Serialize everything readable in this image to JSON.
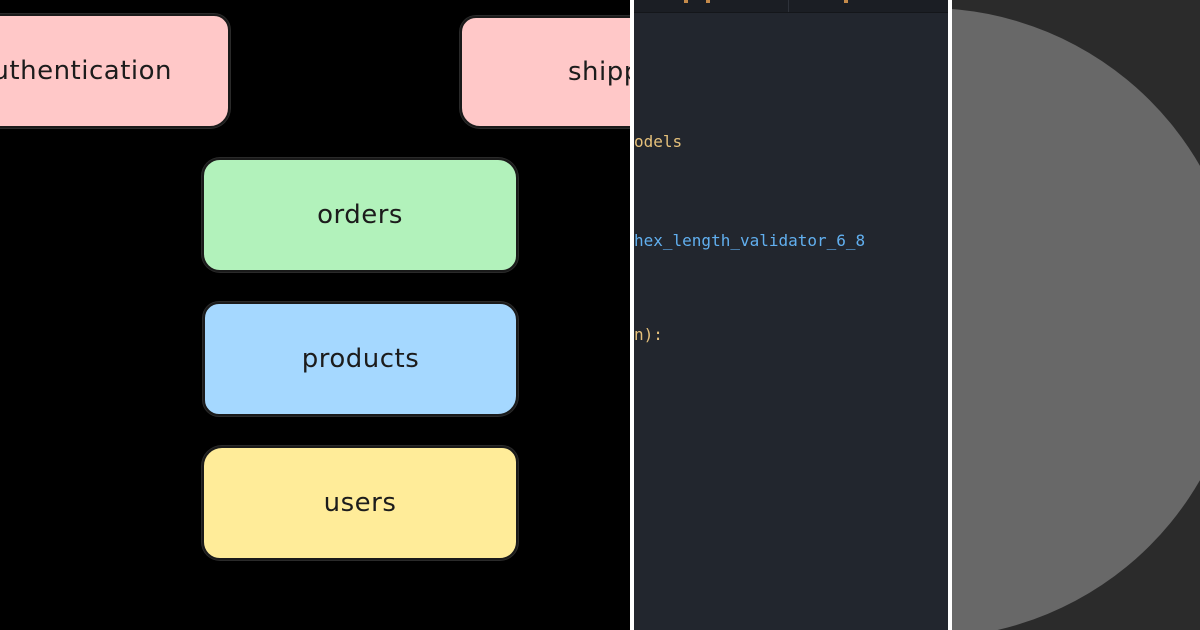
{
  "diagram": {
    "modules": [
      {
        "id": "authentication",
        "label": "uthentication",
        "color": "#ffc8c8"
      },
      {
        "id": "shipping",
        "label": "shipp",
        "color": "#ffc8c8"
      },
      {
        "id": "orders",
        "label": "orders",
        "color": "#b2f2bb"
      },
      {
        "id": "products",
        "label": "products",
        "color": "#a5d8ff"
      },
      {
        "id": "users",
        "label": "users",
        "color": "#ffec99"
      }
    ]
  },
  "code_editor": {
    "lines": [
      {
        "text": "odels",
        "color": "#e5c07b"
      },
      {
        "text": "hex_length_validator_6_8",
        "color": "#61afef"
      },
      {
        "text": "n):",
        "color": "#e5c07b"
      }
    ],
    "tab_accent": "#c58a4a"
  },
  "avatar": {
    "circle_color": "#686868",
    "background": "#2b2b2b"
  }
}
